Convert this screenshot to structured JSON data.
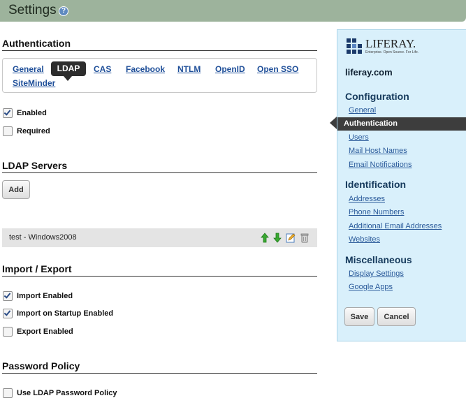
{
  "header": {
    "title": "Settings",
    "help_glyph": "?"
  },
  "authentication": {
    "title": "Authentication",
    "tabs": [
      "General",
      "LDAP",
      "CAS",
      "Facebook",
      "NTLM",
      "OpenID",
      "Open SSO",
      "SiteMinder"
    ],
    "active_tab": "LDAP",
    "enabled_label": "Enabled",
    "enabled_checked": true,
    "required_label": "Required",
    "required_checked": false
  },
  "ldap_servers": {
    "title": "LDAP Servers",
    "add_label": "Add",
    "servers": [
      {
        "name": "test - Windows2008"
      }
    ],
    "row_icons": [
      "move-up-icon",
      "move-down-icon",
      "edit-icon",
      "delete-icon"
    ]
  },
  "import_export": {
    "title": "Import / Export",
    "import_enabled_label": "Import Enabled",
    "import_enabled_checked": true,
    "import_startup_label": "Import on Startup Enabled",
    "import_startup_checked": true,
    "export_enabled_label": "Export Enabled",
    "export_enabled_checked": false
  },
  "password_policy": {
    "title": "Password Policy",
    "use_ldap_label": "Use LDAP Password Policy",
    "use_ldap_checked": false
  },
  "sidebar": {
    "logo_text": "LIFERAY.",
    "logo_tagline": "Enterprise. Open Source. For Life.",
    "site_name": "liferay.com",
    "configuration_title": "Configuration",
    "configuration_items": [
      "General",
      "Authentication",
      "Users",
      "Mail Host Names",
      "Email Notifications"
    ],
    "active_item": "Authentication",
    "identification_title": "Identification",
    "identification_items": [
      "Addresses",
      "Phone Numbers",
      "Additional Email Addresses",
      "Websites"
    ],
    "miscellaneous_title": "Miscellaneous",
    "miscellaneous_items": [
      "Display Settings",
      "Google Apps"
    ],
    "save_label": "Save",
    "cancel_label": "Cancel"
  },
  "colors": {
    "header_bg": "#9db39c",
    "sidebar_bg": "#d9f0fb",
    "link": "#1f4f99",
    "active_tab_bg": "#2d2d2d",
    "arrow_up": "#3aa832",
    "arrow_down": "#3aa832"
  }
}
